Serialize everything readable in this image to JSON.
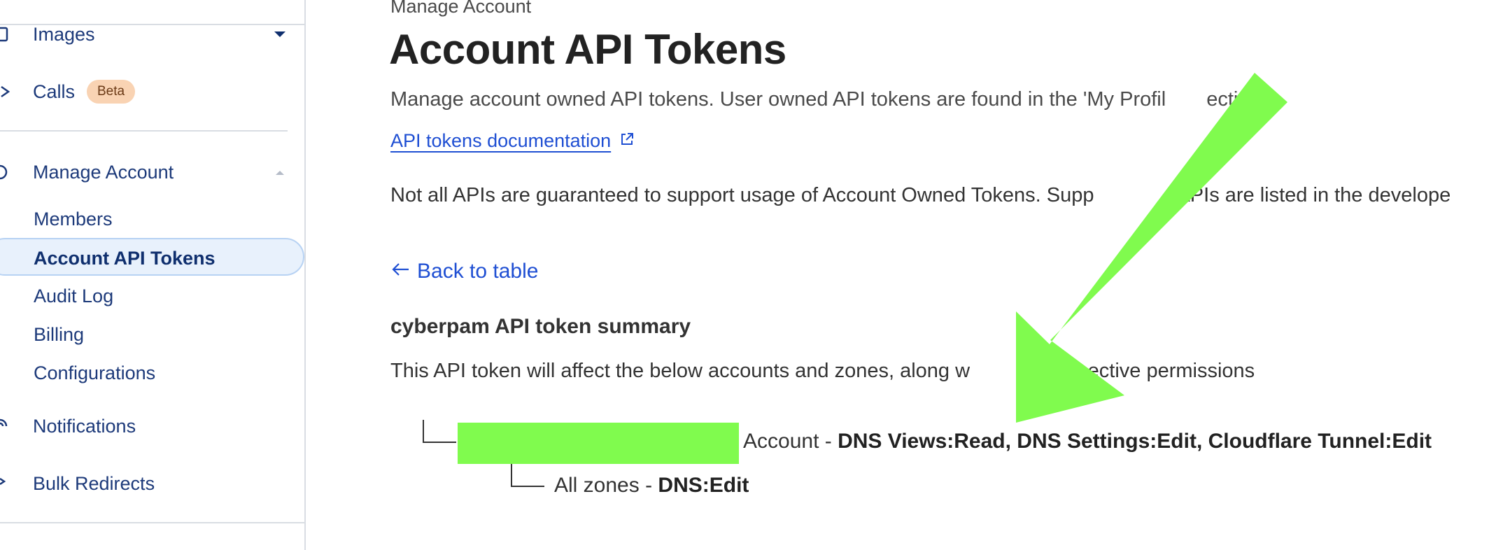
{
  "sidebar": {
    "items": [
      {
        "label": "Images"
      },
      {
        "label": "Calls",
        "badge": "Beta"
      },
      {
        "label": "Manage Account"
      },
      {
        "label": "Notifications"
      },
      {
        "label": "Bulk Redirects"
      }
    ],
    "sub_items": [
      {
        "label": "Members"
      },
      {
        "label": "Account API Tokens"
      },
      {
        "label": "Audit Log"
      },
      {
        "label": "Billing"
      },
      {
        "label": "Configurations"
      }
    ]
  },
  "main": {
    "breadcrumb": "Manage Account",
    "title": "Account API Tokens",
    "description": "Manage account owned API tokens. User owned API tokens are found in the 'My Profil",
    "description_tail": "ection.",
    "doc_link": "API tokens documentation",
    "notice": "Not all APIs are guaranteed to support usage of Account Owned Tokens. Supp",
    "notice_tail": "APIs are listed in the develope",
    "back_link": "Back to table",
    "summary_title": "cyberpam API token summary",
    "summary_desc": "This API token will affect the below accounts and zones, along w",
    "summary_desc_tail": "ir respective permissions",
    "account_row": {
      "label": "Account -",
      "permissions": "DNS Views:Read, DNS Settings:Edit, Cloudflare Tunnel:Edit"
    },
    "zone_row": {
      "label": "All zones -",
      "permissions": "DNS:Edit"
    }
  },
  "colors": {
    "link": "#1f4fd3",
    "nav_text": "#1d3a7a",
    "highlight_green": "#80fb4e",
    "badge_bg": "#f9d3b3",
    "active_bg": "#e8f1fc"
  },
  "icons": [
    "images-icon",
    "calls-icon",
    "manage-account-icon",
    "notifications-icon",
    "bulk-redirects-icon",
    "chevron-down-icon",
    "chevron-up-icon",
    "external-link-icon",
    "arrow-left-icon"
  ]
}
